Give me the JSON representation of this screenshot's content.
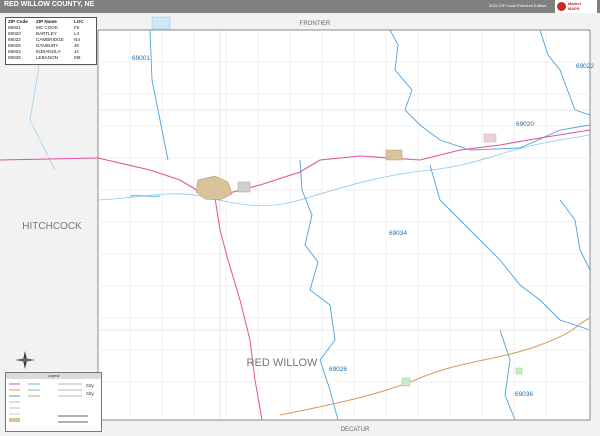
{
  "header": {
    "title": "RED WILLOW COUNTY, NE",
    "edition": "2024 ZIP Code Premium Edition",
    "logo_text": [
      "Market",
      "MAPS"
    ]
  },
  "legend_table": {
    "columns": [
      "ZIP Code",
      "ZIP Name",
      "LOC"
    ],
    "rows": [
      [
        "69001",
        "MC COOK",
        "F5"
      ],
      [
        "69020",
        "BARTLEY",
        "L4"
      ],
      [
        "69022",
        "CAMBRIDGE",
        "N4"
      ],
      [
        "69026",
        "DANBURY",
        "J8"
      ],
      [
        "69034",
        "INDIANOLA",
        "J4"
      ],
      [
        "69036",
        "LEBANON",
        "M8"
      ]
    ]
  },
  "map_labels": {
    "county_main": "RED WILLOW",
    "county_west": "HITCHCOCK",
    "county_north": "FRONTIER",
    "county_south": "DECATUR",
    "zips": [
      "69001",
      "69020",
      "69022",
      "69034",
      "69026",
      "69036"
    ]
  },
  "key": {
    "title": "Legend",
    "city_label": "City"
  },
  "colors": {
    "header": "#808080",
    "zip_boundary": "#4aa3df",
    "highway": "#e0529c",
    "road": "#d79a5a",
    "water": "#8ec9ee",
    "city": "#d9c39a"
  }
}
